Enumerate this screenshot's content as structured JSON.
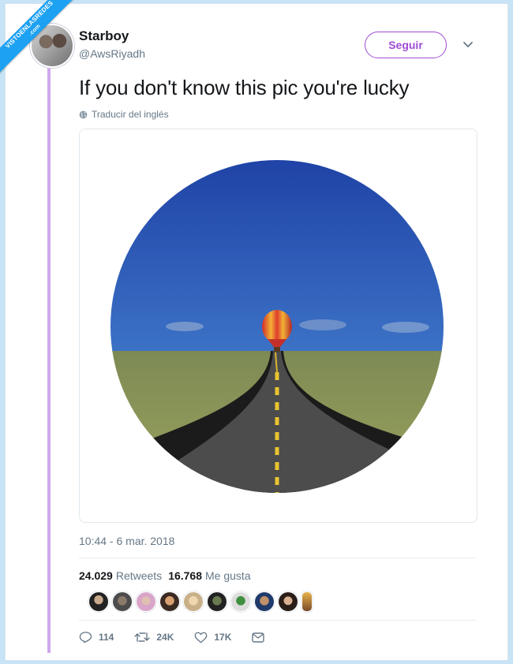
{
  "watermark": {
    "line1": "VISTOENLASREDES",
    "line2": ".com"
  },
  "user": {
    "display_name": "Starboy",
    "handle": "@AwsRiyadh"
  },
  "follow": {
    "label": "Seguir"
  },
  "tweet": {
    "text": "If you don't know this pic you're lucky",
    "translate_label": "Traducir del inglés",
    "timestamp": "10:44 - 6 mar. 2018"
  },
  "stats": {
    "retweets_count": "24.029",
    "retweets_label": "Retweets",
    "likes_count": "16.768",
    "likes_label": "Me gusta"
  },
  "actions": {
    "replies": "114",
    "retweets": "24K",
    "likes": "17K"
  },
  "icons": [
    "globe-icon",
    "chevron-down-icon",
    "reply-icon",
    "retweet-icon",
    "heart-icon",
    "mail-icon"
  ],
  "colors": {
    "accent": "#9f4bd6",
    "thread_line": "#cfa8ef",
    "muted": "#657786",
    "ribbon": "#1da1f2"
  }
}
